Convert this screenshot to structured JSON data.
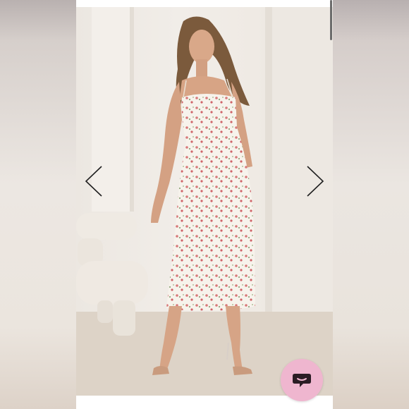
{
  "viewer": {
    "image_subject": "model-wearing-floral-midi-dress",
    "prev_icon": "chevron-left-icon",
    "next_icon": "chevron-right-icon"
  },
  "chat": {
    "icon": "chat-bubble-icon",
    "accent_color": "#efb6cf"
  },
  "colors": {
    "frame": "#ffffff",
    "backdrop": "#ece7e1",
    "dress": "#f7f3ec",
    "floral": "#d8797a"
  }
}
